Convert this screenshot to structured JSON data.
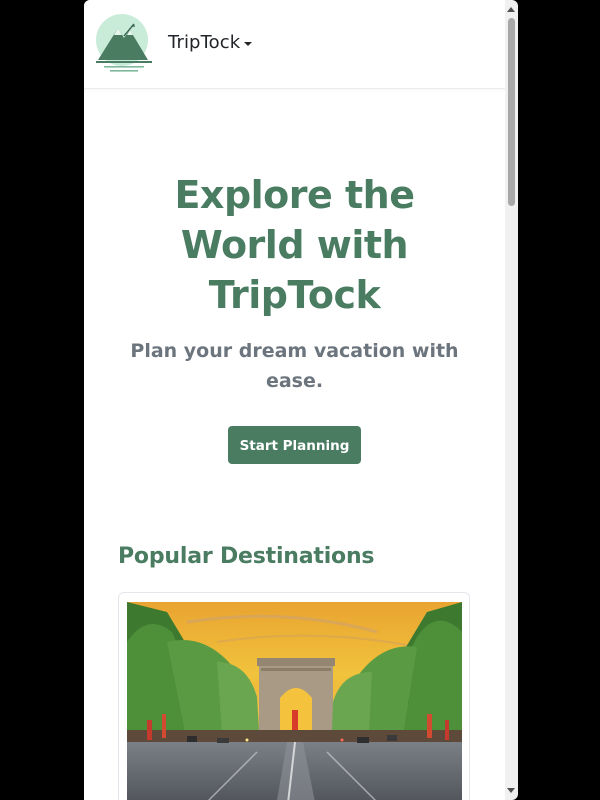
{
  "header": {
    "brand_name": "TripTock"
  },
  "hero": {
    "title": "Explore the World with TripTock",
    "subtitle": "Plan your dream vacation with ease.",
    "cta_label": "Start Planning"
  },
  "destinations": {
    "section_title": "Popular Destinations"
  },
  "colors": {
    "brand_green": "#4a7c62",
    "muted_text": "#6c757d",
    "dark_text": "#212529"
  }
}
